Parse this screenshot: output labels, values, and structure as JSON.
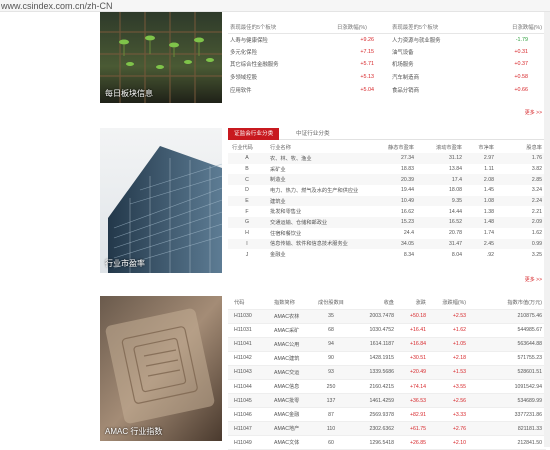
{
  "browser": {
    "url": "www.csindex.com.cn/zh-CN"
  },
  "sections": {
    "daily": {
      "caption": "每日板块信息",
      "headers": [
        "表现最佳的5个板块",
        "日涨跌幅(%)",
        "表现最差的5个板块",
        "日涨跌幅(%)"
      ],
      "rows": [
        {
          "best": "人寿与健康保险",
          "best_pct": "+9.26",
          "worst": "人力资源与就业服务",
          "worst_pct": "-1.79"
        },
        {
          "best": "多元化保险",
          "best_pct": "+7.15",
          "worst": "油气设备",
          "worst_pct": "+0.31"
        },
        {
          "best": "其它综合性金融服务",
          "best_pct": "+5.71",
          "worst": "机场服务",
          "worst_pct": "+0.37"
        },
        {
          "best": "多领域控股",
          "best_pct": "+5.13",
          "worst": "汽车制造商",
          "worst_pct": "+0.58"
        },
        {
          "best": "应用软件",
          "best_pct": "+5.04",
          "worst": "食品分销商",
          "worst_pct": "+0.66"
        }
      ],
      "more": "更多 >>"
    },
    "industry": {
      "caption": "行业市盈率",
      "tabs": [
        "证监会行业分类",
        "中证行业分类"
      ],
      "headers": [
        "行业代码",
        "行业名称",
        "静态市盈率",
        "滚动市盈率",
        "市净率",
        "股息率"
      ],
      "rows": [
        {
          "code": "A",
          "name": "农、林、牧、渔业",
          "static_pe": "27.34",
          "ttm_pe": "31.12",
          "pb": "2.97",
          "div": "1.76"
        },
        {
          "code": "B",
          "name": "采矿业",
          "static_pe": "18.83",
          "ttm_pe": "13.84",
          "pb": "1.11",
          "div": "3.82"
        },
        {
          "code": "C",
          "name": "制造业",
          "static_pe": "20.39",
          "ttm_pe": "17.4",
          "pb": "2.08",
          "div": "2.85"
        },
        {
          "code": "D",
          "name": "电力、热力、燃气及水的生产和供应业",
          "static_pe": "19.44",
          "ttm_pe": "18.08",
          "pb": "1.45",
          "div": "3.24"
        },
        {
          "code": "E",
          "name": "建筑业",
          "static_pe": "10.49",
          "ttm_pe": "9.35",
          "pb": "1.08",
          "div": "2.24"
        },
        {
          "code": "F",
          "name": "批发和零售业",
          "static_pe": "16.62",
          "ttm_pe": "14.44",
          "pb": "1.38",
          "div": "2.21"
        },
        {
          "code": "G",
          "name": "交通运输、仓储和邮政业",
          "static_pe": "15.23",
          "ttm_pe": "16.52",
          "pb": "1.48",
          "div": "2.09"
        },
        {
          "code": "H",
          "name": "住宿和餐饮业",
          "static_pe": "24.4",
          "ttm_pe": "20.78",
          "pb": "1.74",
          "div": "1.62"
        },
        {
          "code": "I",
          "name": "信息传输、软件和信息技术服务业",
          "static_pe": "34.05",
          "ttm_pe": "31.47",
          "pb": "2.45",
          "div": "0.99"
        },
        {
          "code": "J",
          "name": "金融业",
          "static_pe": "8.34",
          "ttm_pe": "8.04",
          "pb": ".92",
          "div": "3.25"
        }
      ],
      "more": "更多 >>"
    },
    "amac": {
      "caption": "AMAC 行业指数",
      "headers": [
        "代码",
        "指数简称",
        "成份股数目",
        "收盘",
        "涨跌",
        "涨跌幅(%)",
        "指数市值(万元)"
      ],
      "rows": [
        {
          "code": "H11030",
          "name": "AMAC农林",
          "count": "35",
          "close": "2003.7478",
          "chg": "+50.18",
          "pct": "+2.53",
          "cap": "210875.46"
        },
        {
          "code": "H11031",
          "name": "AMAC采矿",
          "count": "68",
          "close": "1030.4752",
          "chg": "+16.41",
          "pct": "+1.62",
          "cap": "544985.67"
        },
        {
          "code": "H11041",
          "name": "AMAC公用",
          "count": "94",
          "close": "1614.1187",
          "chg": "+16.84",
          "pct": "+1.05",
          "cap": "563644.88"
        },
        {
          "code": "H11042",
          "name": "AMAC建筑",
          "count": "90",
          "close": "1428.1915",
          "chg": "+30.51",
          "pct": "+2.18",
          "cap": "571755.23"
        },
        {
          "code": "H11043",
          "name": "AMAC交运",
          "count": "93",
          "close": "1339.5686",
          "chg": "+20.49",
          "pct": "+1.53",
          "cap": "528601.51"
        },
        {
          "code": "H11044",
          "name": "AMAC信息",
          "count": "250",
          "close": "2160.4215",
          "chg": "+74.14",
          "pct": "+3.55",
          "cap": "1091542.94"
        },
        {
          "code": "H11045",
          "name": "AMAC批零",
          "count": "137",
          "close": "1461.4259",
          "chg": "+36.53",
          "pct": "+2.56",
          "cap": "534689.99"
        },
        {
          "code": "H11046",
          "name": "AMAC金融",
          "count": "87",
          "close": "2569.9378",
          "chg": "+82.91",
          "pct": "+3.33",
          "cap": "3377231.86"
        },
        {
          "code": "H11047",
          "name": "AMAC地产",
          "count": "110",
          "close": "2302.6362",
          "chg": "+61.75",
          "pct": "+2.76",
          "cap": "821181.33"
        },
        {
          "code": "H11049",
          "name": "AMAC文体",
          "count": "60",
          "close": "1296.5418",
          "chg": "+26.85",
          "pct": "+2.10",
          "cap": "212841.50"
        }
      ]
    }
  },
  "colors": {
    "up": "#d7262a",
    "down": "#2a9d3a",
    "tab_active": "#c8191f"
  }
}
